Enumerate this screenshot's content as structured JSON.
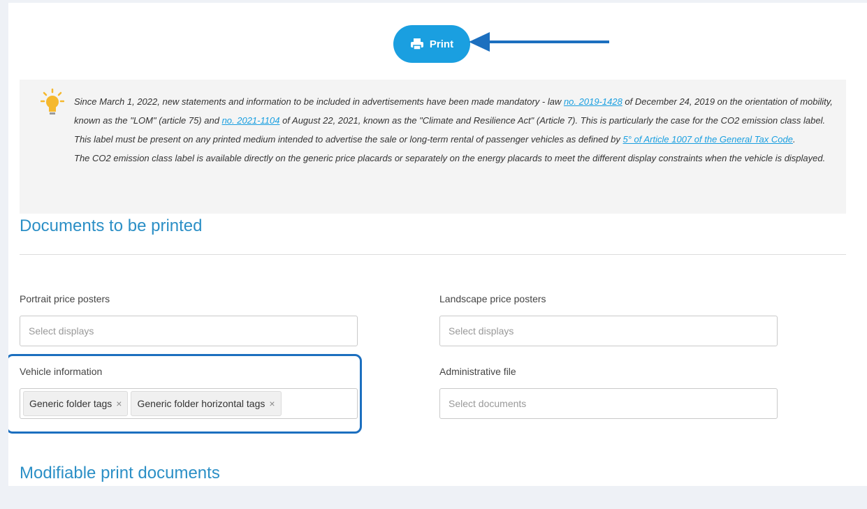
{
  "toolbar": {
    "print_label": "Print"
  },
  "notice": {
    "p1_a": "Since March 1, 2022, new statements and information to be included in advertisements have been made mandatory - law ",
    "link1": "no. 2019-1428",
    "p1_b": " of December 24, 2019 on the orientation of mobility, known as the \"LOM\" (article 75) and ",
    "link2": "no. 2021-1104",
    "p1_c": " of August 22, 2021, known as the \"Climate and Resilience Act\" (Article 7). This is particularly the case for the CO2 emission class label. This label must be present on any printed medium intended to advertise the sale or long-term rental of passenger vehicles as defined by ",
    "link3": "5° of Article 1007 of the General Tax Code",
    "p1_d": ".",
    "p2": "The CO2 emission class label is available directly on the generic price placards or separately on the energy placards to meet the different display constraints when the vehicle is displayed."
  },
  "sections": {
    "documents_title": "Documents to be printed",
    "modifiable_title": "Modifiable print documents"
  },
  "fields": {
    "portrait": {
      "label": "Portrait price posters",
      "placeholder": "Select displays"
    },
    "landscape": {
      "label": "Landscape price posters",
      "placeholder": "Select displays"
    },
    "vehicle": {
      "label": "Vehicle information",
      "tags": [
        "Generic folder tags",
        "Generic folder horizontal tags"
      ],
      "remove_glyph": "×"
    },
    "admin": {
      "label": "Administrative file",
      "placeholder": "Select documents"
    }
  },
  "colors": {
    "accent": "#1a9fe0",
    "highlight": "#1c6fbf",
    "title": "#2b8fc6"
  }
}
